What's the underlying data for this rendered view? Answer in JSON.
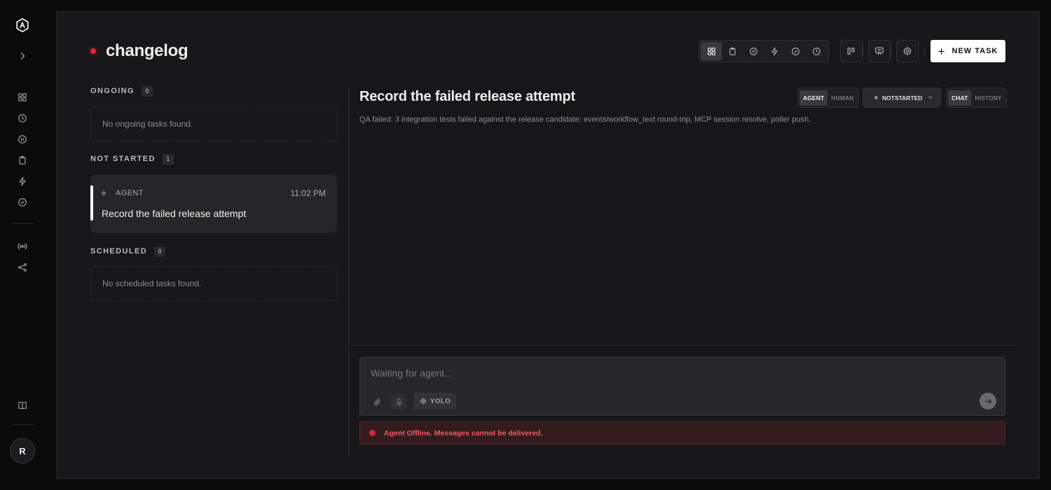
{
  "sidebar": {
    "icons": [
      "app-logo-icon",
      "expand-chevron-icon",
      "grid-icon",
      "clock-icon",
      "pause-icon",
      "clipboard-icon",
      "lightning-icon",
      "check-circle-icon",
      "broadcast-icon",
      "share-nodes-icon",
      "book-icon"
    ],
    "avatar_initial": "R"
  },
  "header": {
    "title": "changelog",
    "status_color": "#e5243b",
    "toolbar_icons": [
      "grid-icon",
      "clipboard-icon",
      "pause-icon",
      "lightning-icon",
      "check-circle-icon",
      "clock-icon"
    ],
    "extra_icons": [
      "board-layout-icon",
      "presentation-icon",
      "settings-gear-icon"
    ],
    "new_task_label": "NEW TASK"
  },
  "sections": {
    "ongoing": {
      "label": "ONGOING",
      "count": "0",
      "empty_text": "No ongoing tasks found."
    },
    "not_started": {
      "label": "NOT STARTED",
      "count": "1",
      "tasks": [
        {
          "assignee": "AGENT",
          "time": "11:02 PM",
          "title": "Record the failed release attempt"
        }
      ]
    },
    "scheduled": {
      "label": "SCHEDULED",
      "count": "0",
      "empty_text": "No scheduled tasks found."
    }
  },
  "detail": {
    "title": "Record the failed release attempt",
    "description": "QA failed: 3 integration tests failed against the release candidate: events/workflow_text round-trip, MCP session resolve, poller push.",
    "assignee_toggle": {
      "agent": "AGENT",
      "human": "HUMAN"
    },
    "status": "NOTSTARTED",
    "view_toggle": {
      "chat": "CHAT",
      "history": "HISTORY"
    }
  },
  "composer": {
    "placeholder": "Waiting for agent...",
    "yolo_label": "YOLO"
  },
  "offline_banner": {
    "text": "Agent Offline. Messages cannot be delivered.",
    "color": "#f05a67"
  }
}
